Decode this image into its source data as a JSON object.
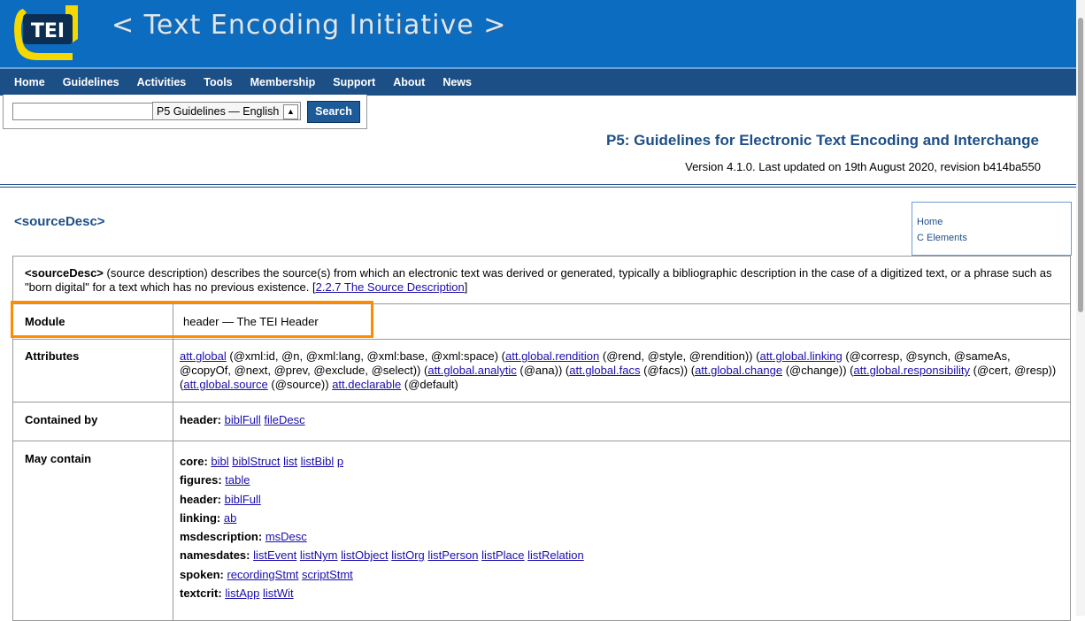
{
  "banner": {
    "logo_text": "TEI",
    "site_title": "< Text Encoding Initiative >"
  },
  "nav": {
    "items": [
      "Home",
      "Guidelines",
      "Activities",
      "Tools",
      "Membership",
      "Support",
      "About",
      "News"
    ]
  },
  "search": {
    "input_value": "",
    "select_value": "P5 Guidelines — English",
    "button_label": "Search"
  },
  "page": {
    "guidelines_title": "P5: Guidelines for Electronic Text Encoding and Interchange",
    "version_text": "Version 4.1.0. Last updated on 19th August 2020, revision b414ba550",
    "element_heading": "<sourceDesc>"
  },
  "sidebar": {
    "links": [
      "Home",
      "C Elements"
    ]
  },
  "description": {
    "element_name": "<sourceDesc>",
    "text": " (source description) describes the source(s) from which an electronic text was derived or generated, typically a bibliographic description in the case of a digitized text, or a phrase such as \"born digital\" for a text which has no previous existence. [",
    "ref_link": "2.2.7 The Source Description",
    "end": "]"
  },
  "module": {
    "label": "Module",
    "value": "header — The TEI Header"
  },
  "attributes": {
    "label": "Attributes",
    "parts": [
      {
        "link": "att.global",
        "text": " (@xml:id, @n, @xml:lang, @xml:base, @xml:space) "
      },
      {
        "link": "att.global.rendition",
        "text": " (@rend, @style, @rendition)) "
      },
      {
        "link": "att.global.linking",
        "text": " (@corresp, @synch, @sameAs, @copyOf, @next, @prev, @exclude, @select)) "
      },
      {
        "link": "att.global.analytic",
        "text": " (@ana)) "
      },
      {
        "link": "att.global.facs",
        "text": " (@facs)) "
      },
      {
        "link": "att.global.change",
        "text": " (@change)) "
      },
      {
        "link": "att.global.responsibility",
        "text": " (@cert, @resp)) "
      },
      {
        "link": "att.global.source",
        "text": " (@source)) "
      },
      {
        "link": "att.declarable",
        "text": " (@default)"
      }
    ]
  },
  "contained_by": {
    "label": "Contained by",
    "groups": [
      {
        "module": "header:",
        "links": [
          "biblFull",
          "fileDesc"
        ]
      }
    ]
  },
  "may_contain": {
    "label": "May contain",
    "groups": [
      {
        "module": "core:",
        "links": [
          "bibl",
          "biblStruct",
          "list",
          "listBibl",
          "p"
        ]
      },
      {
        "module": "figures:",
        "links": [
          "table"
        ]
      },
      {
        "module": "header:",
        "links": [
          "biblFull"
        ]
      },
      {
        "module": "linking:",
        "links": [
          "ab"
        ]
      },
      {
        "module": "msdescription:",
        "links": [
          "msDesc"
        ]
      },
      {
        "module": "namesdates:",
        "links": [
          "listEvent",
          "listNym",
          "listObject",
          "listOrg",
          "listPerson",
          "listPlace",
          "listRelation"
        ]
      },
      {
        "module": "spoken:",
        "links": [
          "recordingStmt",
          "scriptStmt"
        ]
      },
      {
        "module": "textcrit:",
        "links": [
          "listApp",
          "listWit"
        ]
      }
    ]
  },
  "colors": {
    "banner_blue": "#0c6cbf",
    "nav_blue": "#1d4f87",
    "highlight_orange": "#ff8c00"
  }
}
